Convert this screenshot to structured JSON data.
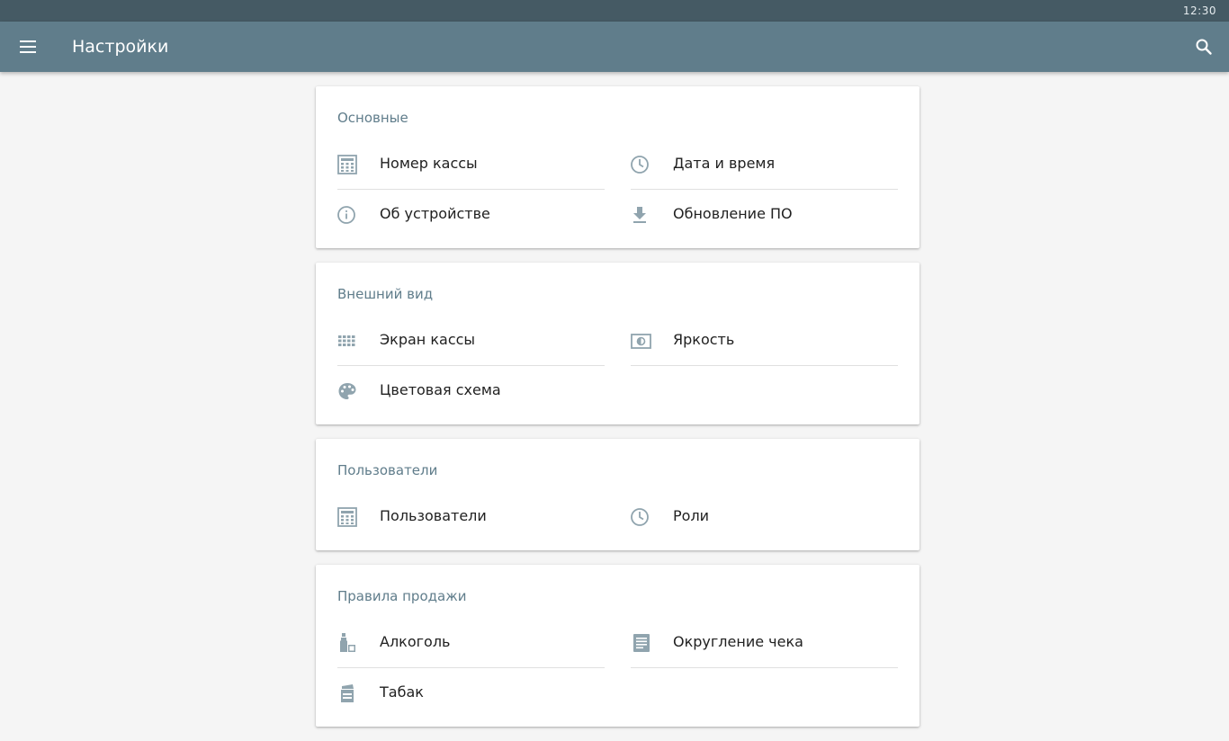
{
  "status_bar": {
    "time": "12:30"
  },
  "app_bar": {
    "menu_icon": "menu-icon",
    "title": "Настройки",
    "search_icon": "search-icon"
  },
  "colors": {
    "status_bar": "#455a64",
    "app_bar": "#607d8b",
    "section_title": "#607d8b",
    "icon": "#90a4ae",
    "background": "#f5f5f5"
  },
  "sections": [
    {
      "title": "Основные",
      "items": [
        {
          "label": "Номер кассы",
          "icon": "calculator-icon"
        },
        {
          "label": "Дата и время",
          "icon": "clock-icon"
        },
        {
          "label": "Об устройстве",
          "icon": "info-icon"
        },
        {
          "label": "Обновление ПО",
          "icon": "download-icon"
        }
      ]
    },
    {
      "title": "Внешний вид",
      "items": [
        {
          "label": "Экран кассы",
          "icon": "grid-icon"
        },
        {
          "label": "Яркость",
          "icon": "brightness-icon"
        },
        {
          "label": "Цветовая схема",
          "icon": "palette-icon"
        }
      ]
    },
    {
      "title": "Пользователи",
      "items": [
        {
          "label": "Пользователи",
          "icon": "calculator-icon"
        },
        {
          "label": "Роли",
          "icon": "clock-icon"
        }
      ]
    },
    {
      "title": "Правила продажи",
      "items": [
        {
          "label": "Алкоголь",
          "icon": "bottle-icon"
        },
        {
          "label": "Округление чека",
          "icon": "receipt-icon"
        },
        {
          "label": "Табак",
          "icon": "tobacco-icon"
        }
      ]
    }
  ]
}
